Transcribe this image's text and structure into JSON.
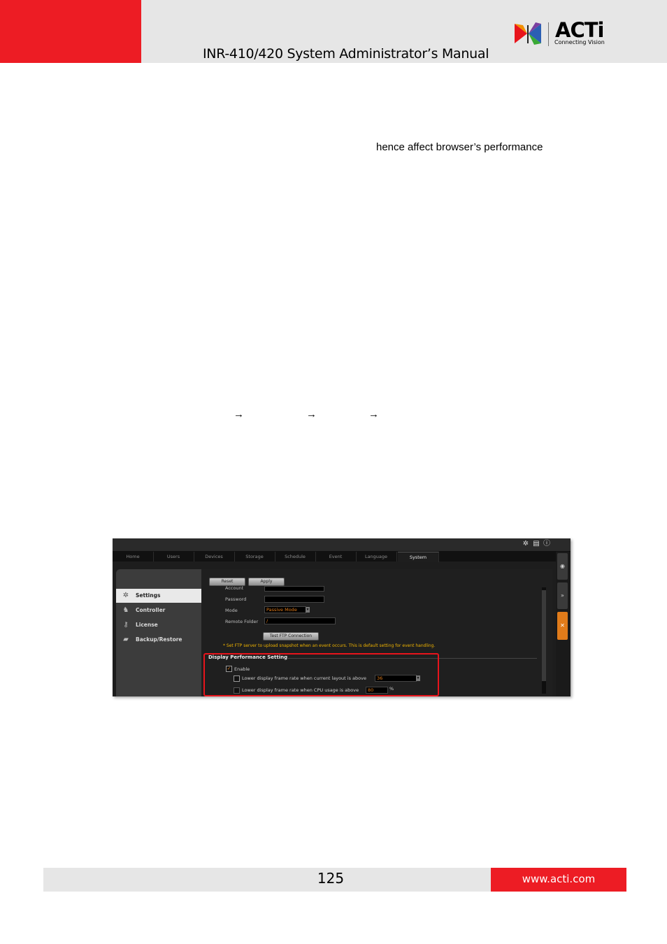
{
  "header": {
    "title": "INR-410/420 System Administrator’s Manual",
    "logo_brand": "ACTi",
    "logo_tagline": "Connecting Vision"
  },
  "body": {
    "fragment": "hence affect browser’s performance",
    "arrow_glyph": "→"
  },
  "screenshot": {
    "top_icons": [
      "gear-icon",
      "document-icon",
      "info-icon"
    ],
    "top_icon_glyphs": [
      "✲",
      "▤",
      "ⓘ"
    ],
    "nav_tabs": [
      "Home",
      "Users",
      "Devices",
      "Storage",
      "Schedule",
      "Event",
      "Language",
      "System"
    ],
    "active_tab": "System",
    "right_buttons": [
      "◉",
      "»",
      "✕"
    ],
    "sidebar": [
      {
        "label": "Settings",
        "icon": "gear-icon",
        "glyph": "✲"
      },
      {
        "label": "Controller",
        "icon": "joystick-icon",
        "glyph": "♞"
      },
      {
        "label": "License",
        "icon": "key-icon",
        "glyph": "⚷"
      },
      {
        "label": "Backup/Restore",
        "icon": "folder-icon",
        "glyph": "▰"
      }
    ],
    "buttons": {
      "reset": "Reset",
      "apply": "Apply",
      "test_ftp": "Test FTP Connection"
    },
    "form": {
      "account_label": "Account",
      "password_label": "Password",
      "mode_label": "Mode",
      "mode_value": "Passive Mode",
      "remote_folder_label": "Remote Folder",
      "remote_folder_value": "/"
    },
    "ftp_note": "* Set FTP server to upload snapshot when an event occurs. This is default setting for event handling.",
    "display_performance": {
      "title": "Display Performance Setting",
      "enable_label": "Enable",
      "enable_checked": true,
      "layout_label": "Lower display frame rate when current layout is above",
      "layout_value": "36",
      "cpu_label": "Lower display frame rate when CPU usage is above",
      "cpu_value": "80",
      "cpu_unit": "%"
    },
    "colors": {
      "accent": "#e07b1a",
      "highlight": "#e8141c"
    }
  },
  "footer": {
    "page_number": "125",
    "url": "www.acti.com"
  }
}
